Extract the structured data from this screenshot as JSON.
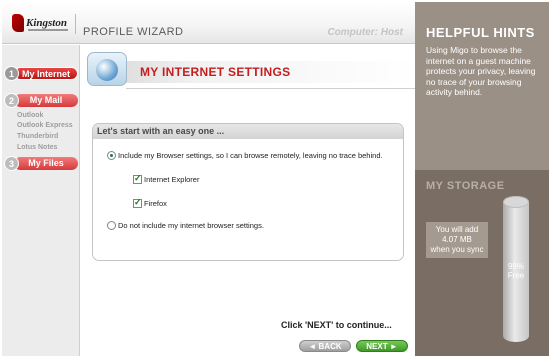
{
  "brand": {
    "logo_text": "Kingston"
  },
  "header": {
    "title": "PROFILE WIZARD",
    "computer": "Computer: Host"
  },
  "sidebar": {
    "steps": [
      {
        "number": "1",
        "label": "My Internet"
      },
      {
        "number": "2",
        "label": "My Mail"
      },
      {
        "number": "3",
        "label": "My Files"
      }
    ],
    "mail_subitems": [
      "Outlook",
      "Outlook Express",
      "Thunderbird",
      "Lotus Notes"
    ]
  },
  "main": {
    "heading": "MY INTERNET SETTINGS",
    "card_title": "Let's start with an easy one ...",
    "option_include": "Include my Browser settings, so I can browse remotely, leaving no trace behind.",
    "browsers": [
      "Internet Explorer",
      "Firefox"
    ],
    "option_exclude": "Do not include my internet browser settings.",
    "continue_text": "Click 'NEXT' to continue..."
  },
  "buttons": {
    "back": "◄ BACK",
    "next": "NEXT ►"
  },
  "hints": {
    "title": "HELPFUL HINTS",
    "text": "Using Migo to browse the internet on a guest machine protects your privacy, leaving no trace of your browsing activity behind."
  },
  "storage": {
    "title": "MY STORAGE",
    "note_line1": "You will add",
    "note_line2": "4.07 MB",
    "note_line3": "when you sync",
    "percent": "99%",
    "percent_label": "Free"
  },
  "colors": {
    "accent_red": "#c41e1e",
    "panel_taupe": "#9b9085",
    "storage_brown": "#796d64",
    "next_green": "#3f9a28"
  },
  "state": {
    "selected_option": "include",
    "internet_explorer_checked": true,
    "firefox_checked": true,
    "storage_free_percent": 99
  }
}
